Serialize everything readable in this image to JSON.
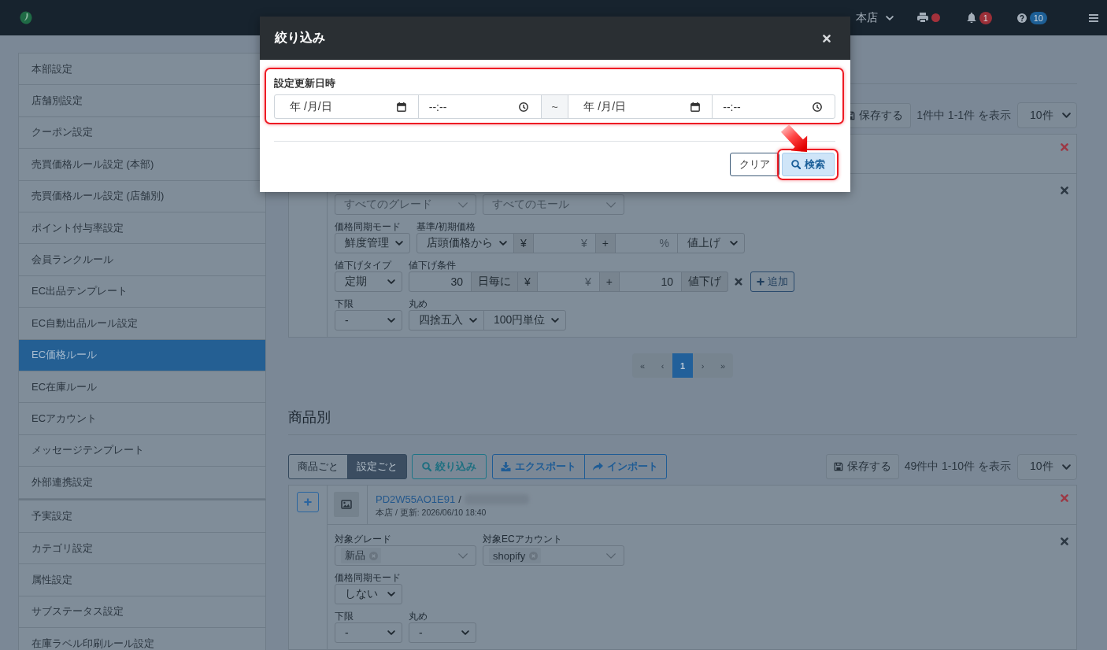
{
  "topbar": {
    "store": "本店",
    "printer_alert": true,
    "notification_count": "1",
    "help_count": "10"
  },
  "sidebar": {
    "groups": [
      {
        "items": [
          {
            "label": "本部設定",
            "selected": false
          },
          {
            "label": "店舗別設定",
            "selected": false
          },
          {
            "label": "クーポン設定",
            "selected": false
          },
          {
            "label": "売買価格ルール設定 (本部)",
            "selected": false
          },
          {
            "label": "売買価格ルール設定 (店舗別)",
            "selected": false
          },
          {
            "label": "ポイント付与率設定",
            "selected": false
          },
          {
            "label": "会員ランクルール",
            "selected": false
          },
          {
            "label": "EC出品テンプレート",
            "selected": false
          },
          {
            "label": "EC自動出品ルール設定",
            "selected": false
          },
          {
            "label": "EC価格ルール",
            "selected": true
          },
          {
            "label": "EC在庫ルール",
            "selected": false
          },
          {
            "label": "ECアカウント",
            "selected": false
          },
          {
            "label": "メッセージテンプレート",
            "selected": false
          },
          {
            "label": "外部連携設定",
            "selected": false
          }
        ]
      },
      {
        "items": [
          {
            "label": "予実設定",
            "selected": false
          },
          {
            "label": "カテゴリ設定",
            "selected": false
          },
          {
            "label": "属性設定",
            "selected": false
          },
          {
            "label": "サブステータス設定",
            "selected": false
          },
          {
            "label": "在庫ラベル印刷ルール設定",
            "selected": false
          }
        ]
      }
    ]
  },
  "rule_section": {
    "save_button": "保存する",
    "count": "1件中 1-1件 を表示",
    "page_size": "10件",
    "card": {
      "rows": [
        {
          "fields": [
            {
              "controls": [
                {
                  "kind": "multiselect",
                  "placeholder": "すべてのグレード"
                }
              ]
            },
            {
              "controls": [
                {
                  "kind": "multiselect",
                  "placeholder": "すべてのモール"
                }
              ]
            }
          ]
        },
        {
          "fields": [
            {
              "label": "価格同期モード",
              "controls": [
                {
                  "kind": "select",
                  "value": "鮮度管理"
                }
              ]
            },
            {
              "label": "基準/初期価格",
              "controls": [
                {
                  "kind": "select",
                  "value": "店頭価格から"
                },
                {
                  "kind": "addon",
                  "text": "¥"
                },
                {
                  "kind": "input",
                  "placeholder": "¥"
                },
                {
                  "kind": "addon",
                  "text": "+"
                },
                {
                  "kind": "input",
                  "placeholder": "%"
                },
                {
                  "kind": "select",
                  "value": "値上げ"
                }
              ]
            }
          ]
        },
        {
          "fields": [
            {
              "label": "値下げタイプ",
              "controls": [
                {
                  "kind": "select",
                  "value": "定期"
                }
              ]
            },
            {
              "label": "値下げ条件",
              "controls": [
                {
                  "kind": "input",
                  "value": "30"
                },
                {
                  "kind": "addon",
                  "text": "日毎に"
                },
                {
                  "kind": "addon",
                  "text": "¥"
                },
                {
                  "kind": "input",
                  "placeholder": "¥"
                },
                {
                  "kind": "addon",
                  "text": "+"
                },
                {
                  "kind": "input",
                  "value": "10"
                },
                {
                  "kind": "addon",
                  "text": "値下げ"
                }
              ]
            },
            {
              "controls": [
                {
                  "kind": "remove"
                }
              ]
            },
            {
              "controls": [
                {
                  "kind": "add_button",
                  "label": "追加"
                }
              ]
            }
          ]
        },
        {
          "fields": [
            {
              "label": "下限",
              "controls": [
                {
                  "kind": "select",
                  "value": "-"
                }
              ]
            },
            {
              "label": "丸め",
              "controls": [
                {
                  "kind": "select",
                  "value": "四捨五入"
                },
                {
                  "kind": "select",
                  "value": "100円単位"
                }
              ]
            }
          ]
        }
      ]
    },
    "pager": [
      {
        "label": "«",
        "selected": false
      },
      {
        "label": "‹",
        "selected": false
      },
      {
        "label": "1",
        "selected": true
      },
      {
        "label": "›",
        "selected": false
      },
      {
        "label": "»",
        "selected": false
      }
    ]
  },
  "product_section": {
    "title": "商品別",
    "view_toggle": [
      {
        "label": "商品ごと",
        "selected": false
      },
      {
        "label": "設定ごと",
        "selected": true
      }
    ],
    "filter_button": "絞り込み",
    "transfer_buttons": [
      {
        "label": "エクスポート",
        "kind": "export"
      },
      {
        "label": "インポート",
        "kind": "import"
      }
    ],
    "save_button": "保存する",
    "count": "49件中 1-10件 を表示",
    "page_size": "10件",
    "card": {
      "expand_button": true,
      "product": {
        "code": "PD2W55AO1E91",
        "separator": "/",
        "name_blurred": true,
        "meta": "本店 / 更新: 2026/06/10 18:40"
      },
      "rows": [
        {
          "fields": [
            {
              "label": "対象グレード",
              "controls": [
                {
                  "kind": "multiselect",
                  "tags": [
                    "新品"
                  ]
                }
              ]
            },
            {
              "label": "対象ECアカウント",
              "controls": [
                {
                  "kind": "multiselect",
                  "tags": [
                    "shopify"
                  ]
                }
              ]
            }
          ]
        },
        {
          "fields": [
            {
              "label": "価格同期モード",
              "controls": [
                {
                  "kind": "select",
                  "value": "しない"
                }
              ]
            }
          ]
        },
        {
          "fields": [
            {
              "label": "下限",
              "controls": [
                {
                  "kind": "select",
                  "value": "-"
                }
              ]
            },
            {
              "label": "丸め",
              "controls": [
                {
                  "kind": "select",
                  "value": "-"
                }
              ]
            }
          ]
        }
      ]
    }
  },
  "filter_modal": {
    "title": "絞り込み",
    "date_range": {
      "label": "設定更新日時",
      "highlighted": true,
      "fields": [
        {
          "kind": "date",
          "placeholder": "年 /月/日"
        },
        {
          "kind": "time",
          "placeholder": "--:--"
        },
        {
          "kind": "separator",
          "text": "~"
        },
        {
          "kind": "date",
          "placeholder": "年 /月/日"
        },
        {
          "kind": "time",
          "placeholder": "--:--"
        }
      ]
    },
    "buttons": [
      {
        "label": "クリア",
        "kind": "secondary",
        "highlighted": false,
        "pointer": false
      },
      {
        "label": "検索",
        "kind": "primary",
        "highlighted": true,
        "pointer": true
      }
    ]
  }
}
